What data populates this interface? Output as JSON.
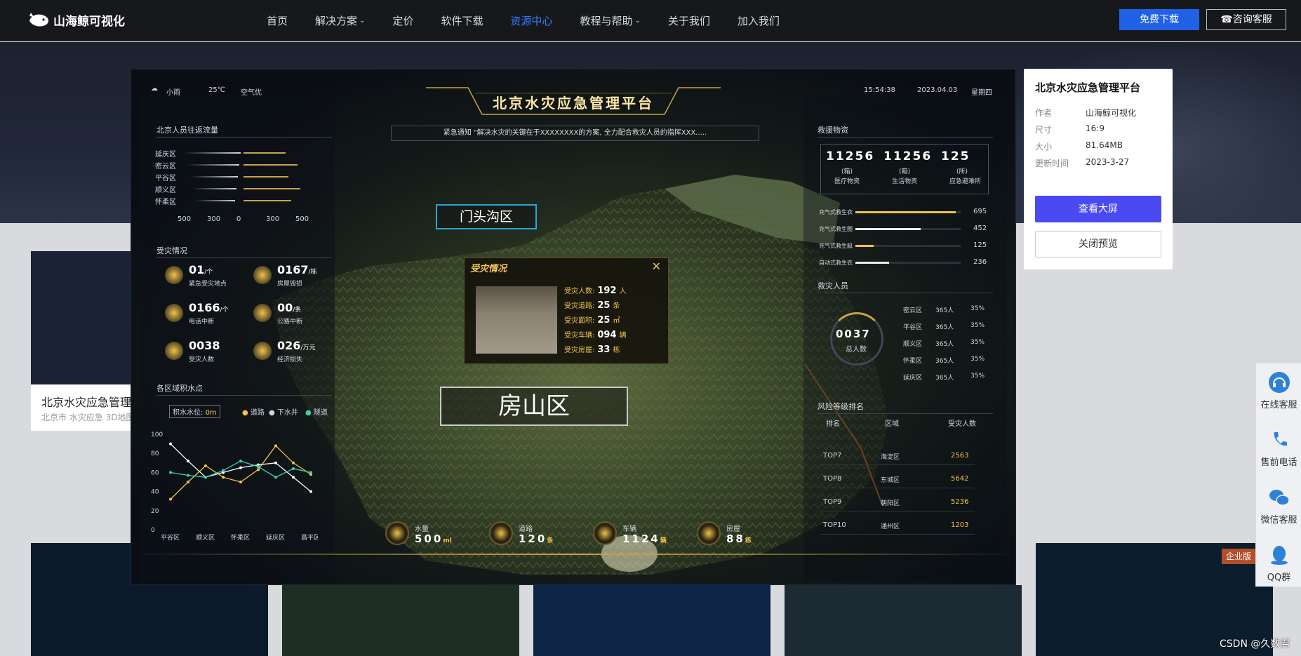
{
  "nav": {
    "logo_text": "山海鲸可视化",
    "items": [
      {
        "label": "首页",
        "has_dropdown": false,
        "active": false
      },
      {
        "label": "解决方案",
        "has_dropdown": true,
        "active": false
      },
      {
        "label": "定价",
        "has_dropdown": false,
        "active": false
      },
      {
        "label": "软件下载",
        "has_dropdown": false,
        "active": false
      },
      {
        "label": "资源中心",
        "has_dropdown": false,
        "active": true
      },
      {
        "label": "教程与帮助",
        "has_dropdown": true,
        "active": false
      },
      {
        "label": "关于我们",
        "has_dropdown": false,
        "active": false
      },
      {
        "label": "加入我们",
        "has_dropdown": false,
        "active": false
      }
    ],
    "free_download": "免费下载",
    "consult": "咨询客服"
  },
  "bg_card": {
    "title": "北京水灾应急管理",
    "tags": "北京市  水灾应急  3D地图"
  },
  "enterprise_badge": "企业版",
  "dashboard": {
    "title": "北京水灾应急管理平台",
    "weather": "小雨",
    "temp": "25℃",
    "air": "空气优",
    "time": "15:54:38",
    "date": "2023.04.03",
    "weekday": "星期四",
    "notice": "紧急通知 \"解决水灾的关键在于XXXXXXXX的方案, 全力配合救灾人员的指挥XXX.....",
    "left": {
      "flow_title": "北京人员往返流量",
      "flow_rows": [
        "延庆区",
        "密云区",
        "平谷区",
        "顺义区",
        "怀柔区"
      ],
      "flow_axis": [
        "500",
        "300",
        "0",
        "300",
        "500"
      ],
      "disaster_title": "受灾情况",
      "disaster": [
        {
          "num": "01",
          "unit": "/个",
          "label": "紧急受灾地点"
        },
        {
          "num": "0167",
          "unit": "/栋",
          "label": "房屋毁损"
        },
        {
          "num": "0166",
          "unit": "/个",
          "label": "电话中断"
        },
        {
          "num": "00",
          "unit": "/条",
          "label": "公路中断"
        },
        {
          "num": "0038",
          "unit": "",
          "label": "受灾人数"
        },
        {
          "num": "026",
          "unit": "/万元",
          "label": "经济损失"
        }
      ],
      "water_title": "各区域积水点",
      "water_level_label": "积水水位:",
      "water_level_value": "0m",
      "legend": [
        "道路",
        "下水井",
        "隧道"
      ],
      "y_ticks": [
        "100",
        "80",
        "60",
        "40",
        "20",
        "0"
      ],
      "x_cats": [
        "平谷区",
        "顺义区",
        "怀柔区",
        "延庆区",
        "昌平区"
      ]
    },
    "chart_data": {
      "type": "line",
      "categories": [
        "平谷区",
        "",
        "顺义区",
        "",
        "怀柔区",
        "",
        "延庆区",
        "",
        "昌平区"
      ],
      "ylim": [
        0,
        100
      ],
      "series": [
        {
          "name": "道路",
          "color": "#f2c14a",
          "values": [
            32,
            50,
            67,
            55,
            50,
            63,
            88,
            70,
            58
          ]
        },
        {
          "name": "下水井",
          "color": "#ffffff",
          "values": [
            90,
            72,
            55,
            60,
            65,
            68,
            70,
            55,
            40
          ]
        },
        {
          "name": "隧道",
          "color": "#38d3b4",
          "values": [
            60,
            57,
            55,
            62,
            72,
            66,
            55,
            64,
            60
          ]
        }
      ]
    },
    "right": {
      "supply_title": "救援物资",
      "supplies": [
        {
          "num": "11256",
          "unit": "(箱)",
          "label": "医疗物资"
        },
        {
          "num": "11256",
          "unit": "(箱)",
          "label": "生活物资"
        },
        {
          "num": "125",
          "unit": "(所)",
          "label": "应急避难所"
        }
      ],
      "bars": [
        {
          "label": "充气式救生衣",
          "value": 695,
          "fill": 0.95
        },
        {
          "label": "充气式救生圈",
          "value": 452,
          "fill": 0.62
        },
        {
          "label": "充气式救生艇",
          "value": 125,
          "fill": 0.17
        },
        {
          "label": "自动式救生衣",
          "value": 236,
          "fill": 0.32
        }
      ],
      "rescue_title": "救灾人员",
      "rescue_total": "0037",
      "rescue_total_label": "总人数",
      "rescue_rows": [
        {
          "area": "密云区",
          "count": "365人",
          "pct": "35%"
        },
        {
          "area": "平谷区",
          "count": "365人",
          "pct": "35%"
        },
        {
          "area": "顺义区",
          "count": "365人",
          "pct": "35%"
        },
        {
          "area": "怀柔区",
          "count": "365人",
          "pct": "35%"
        },
        {
          "area": "延庆区",
          "count": "365人",
          "pct": "35%"
        }
      ],
      "risk_title": "风险等级排名",
      "risk_headers": [
        "排名",
        "区域",
        "受灾人数"
      ],
      "risk_rows": [
        {
          "rank": "TOP7",
          "area": "海淀区",
          "num": "2563"
        },
        {
          "rank": "TOP8",
          "area": "东城区",
          "num": "5642"
        },
        {
          "rank": "TOP9",
          "area": "朝阳区",
          "num": "5236"
        },
        {
          "rank": "TOP10",
          "area": "通州区",
          "num": "1203"
        }
      ]
    },
    "bottom": [
      {
        "label": "水量",
        "num": "500",
        "unit": "ml"
      },
      {
        "label": "道路",
        "num": "120",
        "unit": "条"
      },
      {
        "label": "车辆",
        "num": "1124",
        "unit": "辆"
      },
      {
        "label": "房屋",
        "num": "88",
        "unit": "栋"
      }
    ],
    "region_mentougou": "门头沟区",
    "region_fangshan": "房山区",
    "popup": {
      "title": "受灾情况",
      "rows": [
        {
          "label": "受灾人数:",
          "num": "192",
          "unit": "人"
        },
        {
          "label": "受灾道路:",
          "num": "25",
          "unit": "条"
        },
        {
          "label": "受灾面积:",
          "num": "25",
          "unit": "㎡"
        },
        {
          "label": "受灾车辆:",
          "num": "094",
          "unit": "辆"
        },
        {
          "label": "受灾房屋:",
          "num": "33",
          "unit": "栋"
        }
      ]
    }
  },
  "detail": {
    "title": "北京水灾应急管理平台",
    "rows": [
      {
        "label": "作者",
        "value": "山海鲸可视化"
      },
      {
        "label": "尺寸",
        "value": "16:9"
      },
      {
        "label": "大小",
        "value": "81.64MB"
      },
      {
        "label": "更新时间",
        "value": "2023-3-27"
      }
    ],
    "view_button": "查看大屏",
    "close_button": "关闭预览"
  },
  "float": [
    {
      "label": "在线客服",
      "icon": "headset-icon"
    },
    {
      "label": "售前电话",
      "icon": "phone-icon"
    },
    {
      "label": "微信客服",
      "icon": "wechat-icon"
    },
    {
      "label": "QQ群",
      "icon": "qq-icon"
    }
  ],
  "watermark": "CSDN @久数君"
}
